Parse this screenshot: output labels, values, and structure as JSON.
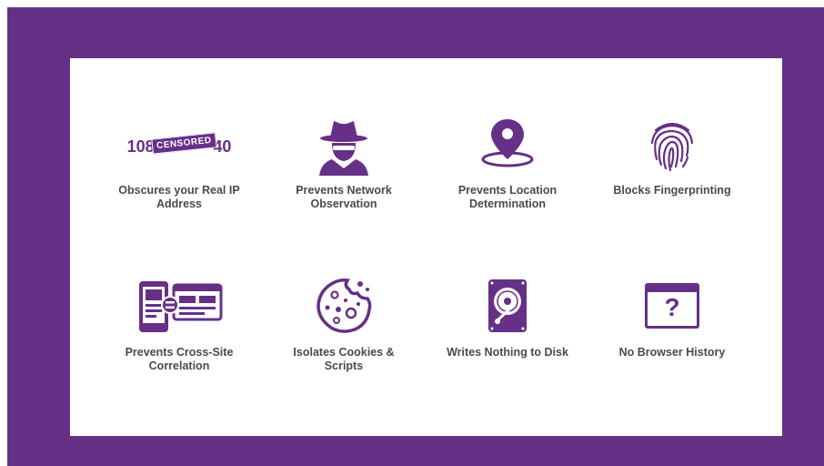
{
  "colors": {
    "brand": "#663087",
    "text": "#4a4a4a",
    "panel": "#ffffff"
  },
  "features": [
    {
      "icon": "censored-ip-icon",
      "ip_prefix": "108",
      "ip_censor": "CENSORED",
      "ip_suffix": "40",
      "lines": [
        "Obscures your Real IP",
        "Address"
      ]
    },
    {
      "icon": "spy-icon",
      "lines": [
        "Prevents Network",
        "Observation"
      ]
    },
    {
      "icon": "location-pin-icon",
      "lines": [
        "Prevents Location",
        "Determination"
      ]
    },
    {
      "icon": "fingerprint-icon",
      "lines": [
        "Blocks Fingerprinting"
      ]
    },
    {
      "icon": "cross-site-icon",
      "lines": [
        "Prevents Cross-Site",
        "Correlation"
      ]
    },
    {
      "icon": "cookie-icon",
      "lines": [
        "Isolates Cookies &",
        "Scripts"
      ]
    },
    {
      "icon": "hard-disk-icon",
      "lines": [
        "Writes Nothing to Disk"
      ]
    },
    {
      "icon": "browser-question-icon",
      "question_mark": "?",
      "lines": [
        "No Browser History"
      ]
    }
  ]
}
